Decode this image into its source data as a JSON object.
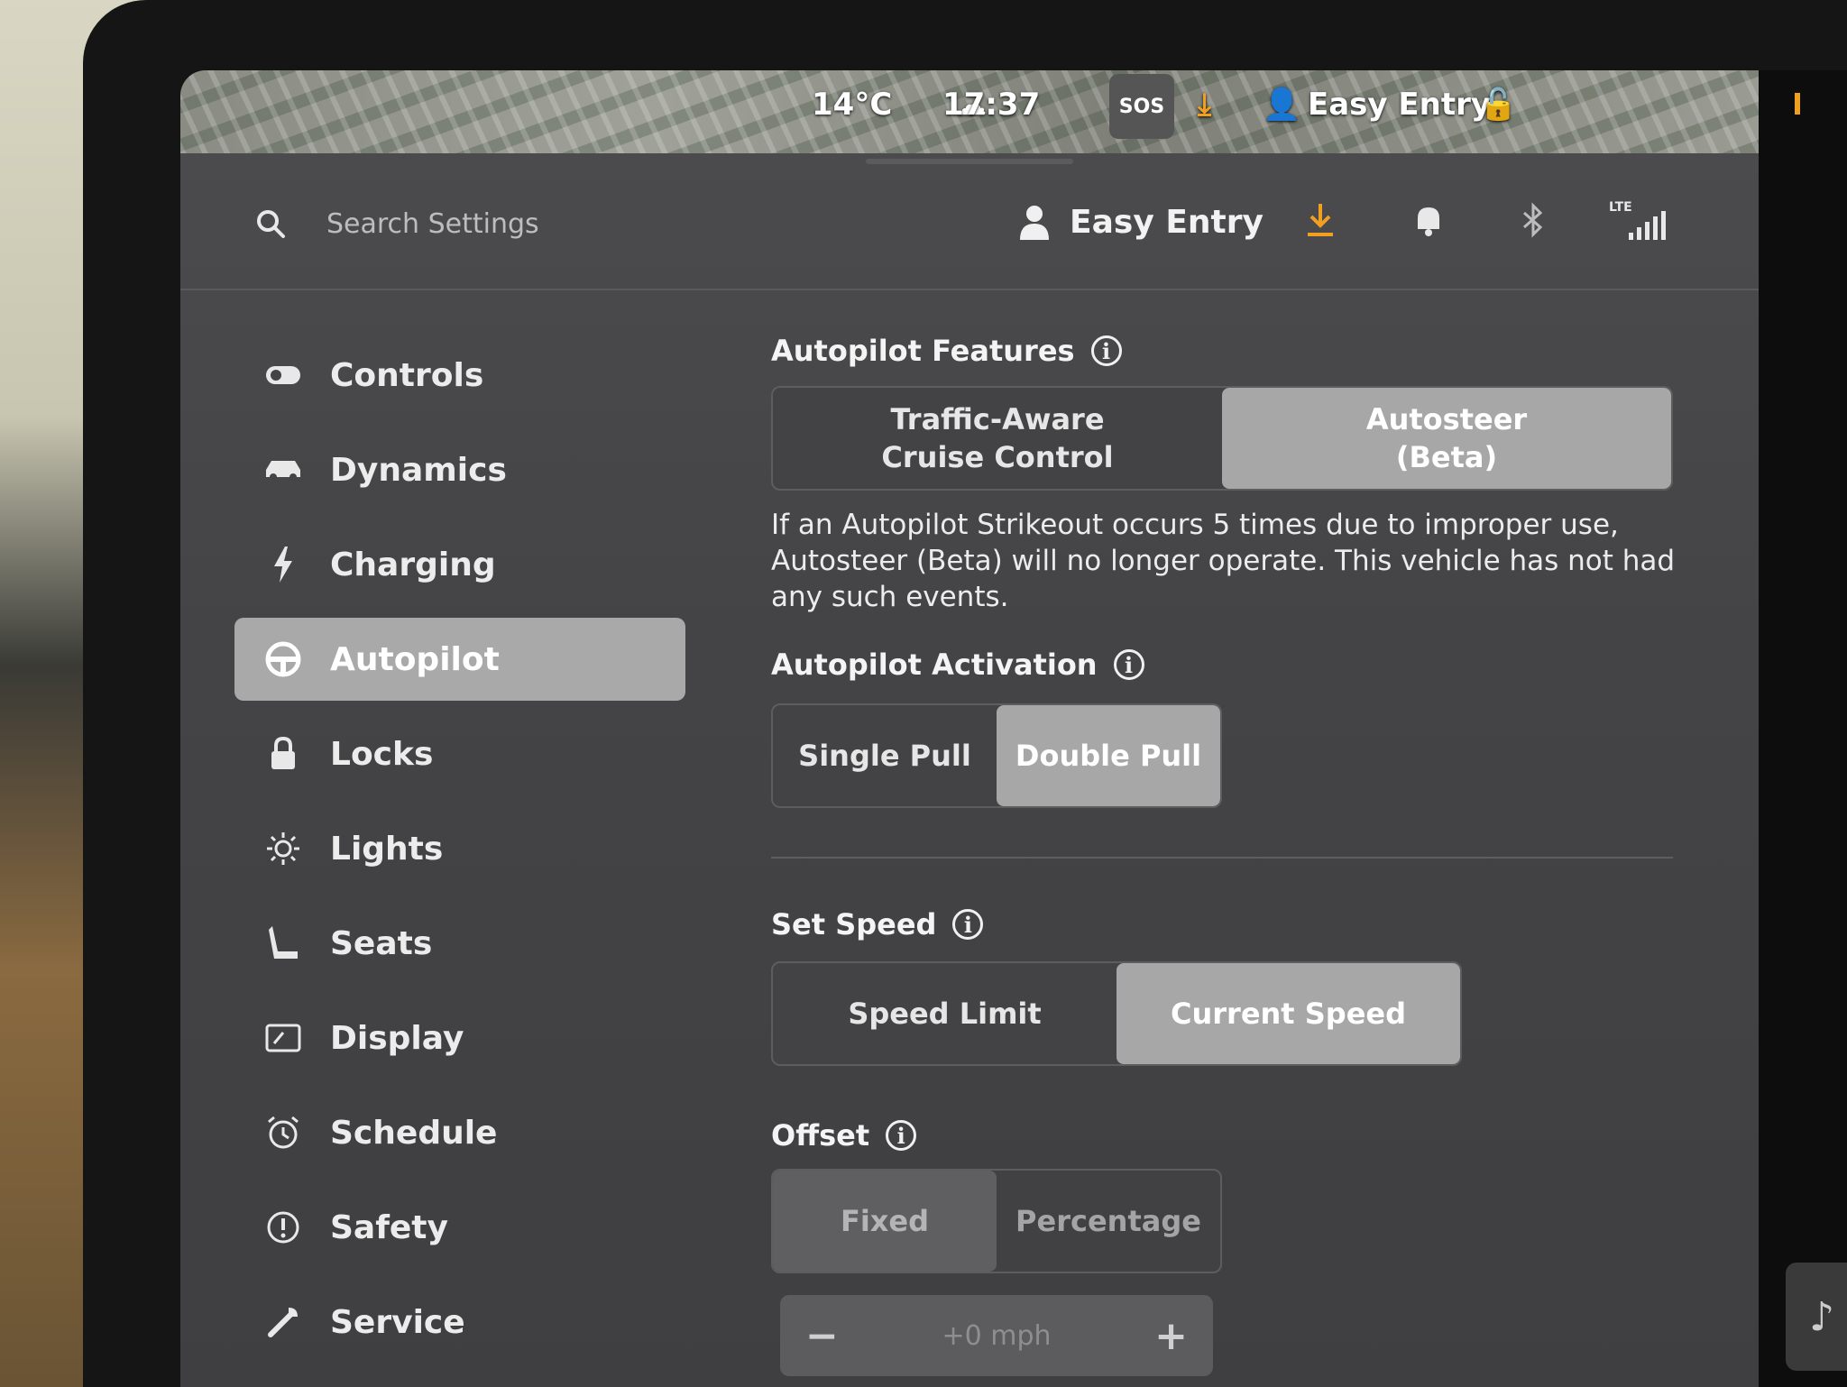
{
  "status_bar": {
    "temperature": "14°C",
    "time": "17:37",
    "sos": "SOS",
    "profile": "Easy Entry"
  },
  "top_bar": {
    "search_placeholder": "Search Settings",
    "profile_name": "Easy Entry",
    "network": "LTE"
  },
  "sidebar": {
    "items": [
      {
        "label": "Controls",
        "icon": "toggle-icon"
      },
      {
        "label": "Dynamics",
        "icon": "car-icon"
      },
      {
        "label": "Charging",
        "icon": "lightning-icon"
      },
      {
        "label": "Autopilot",
        "icon": "steering-wheel-icon",
        "active": true
      },
      {
        "label": "Locks",
        "icon": "lock-icon"
      },
      {
        "label": "Lights",
        "icon": "sun-icon"
      },
      {
        "label": "Seats",
        "icon": "seat-icon"
      },
      {
        "label": "Display",
        "icon": "display-icon"
      },
      {
        "label": "Schedule",
        "icon": "alarm-clock-icon"
      },
      {
        "label": "Safety",
        "icon": "alert-circle-icon"
      },
      {
        "label": "Service",
        "icon": "wrench-icon"
      }
    ]
  },
  "autopilot_features": {
    "title": "Autopilot Features",
    "option_1_line_1": "Traffic-Aware",
    "option_1_line_2": "Cruise Control",
    "option_2_line_1": "Autosteer",
    "option_2_line_2": "(Beta)",
    "selected": "Autosteer (Beta)",
    "description": "If an Autopilot Strikeout occurs 5 times due to improper use, Autosteer (Beta) will no longer operate. This vehicle has not had any such events."
  },
  "autopilot_activation": {
    "title": "Autopilot Activation",
    "options": [
      "Single Pull",
      "Double Pull"
    ],
    "selected": "Double Pull"
  },
  "set_speed": {
    "title": "Set Speed",
    "options": [
      "Speed Limit",
      "Current Speed"
    ],
    "selected": "Current Speed"
  },
  "offset": {
    "title": "Offset",
    "options": [
      "Fixed",
      "Percentage"
    ],
    "selected": "Fixed",
    "stepper": {
      "minus": "−",
      "value": "+0 mph",
      "plus": "+"
    }
  },
  "colors": {
    "accent": "#f0a020",
    "selected_segment": "#a7a7a8",
    "panel": "#444446"
  }
}
